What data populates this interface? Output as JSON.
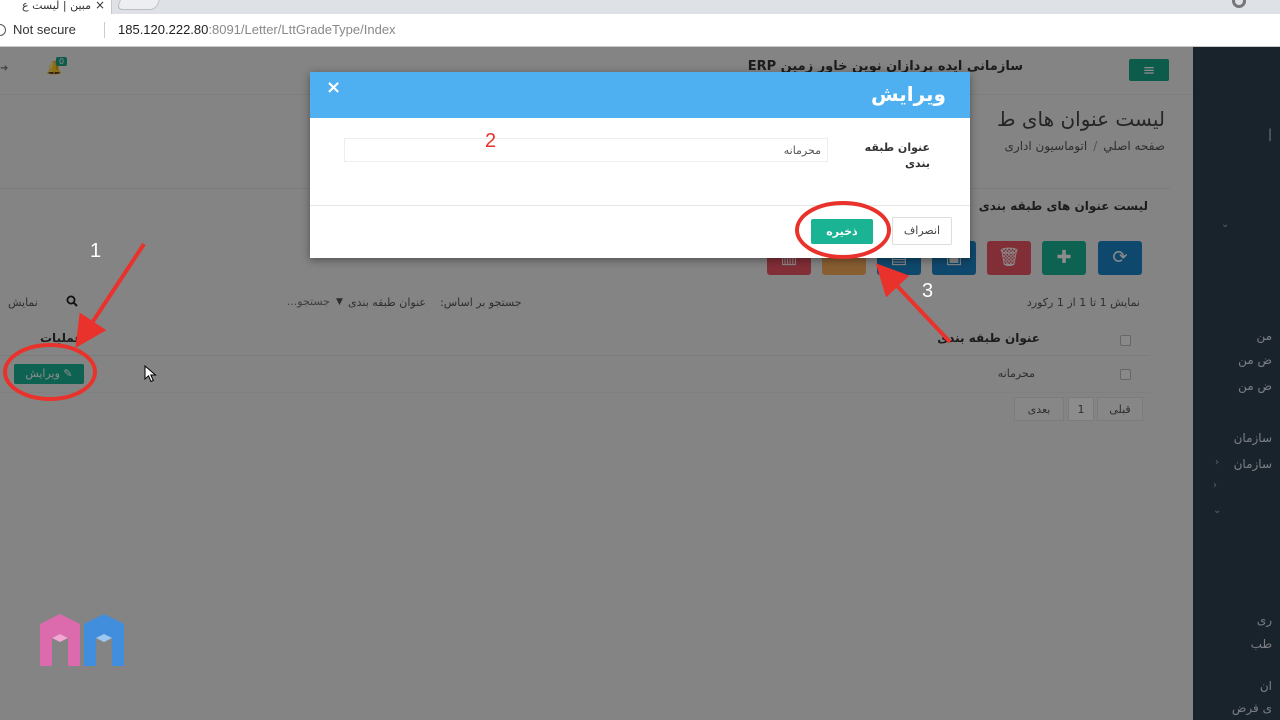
{
  "browser": {
    "tab_title": "مبین | لیست ع",
    "tab_close": "×",
    "security_label": "Not secure",
    "url_host": "185.120.222.80",
    "url_rest": ":8091/Letter/LttGradeType/Index"
  },
  "topbar": {
    "menu_icon": "≡",
    "brand": "سازمانی ایده پردازان نوین خاور زمین ERP",
    "bell_count": "0"
  },
  "sidebar": {
    "items": [
      "من",
      "ض من",
      "ض من",
      "سازمان",
      "سازمان",
      "ری",
      "طب",
      "ان",
      "ی فرض"
    ]
  },
  "page": {
    "title": "لیست عنوان های ط",
    "breadcrumb": [
      "صفحه اصلي",
      "اتوماسیون اداری"
    ]
  },
  "panel": {
    "title": "لیست عنوان های طبقه بندی",
    "records_info": "نمایش 1 تا 1 از 1 رکورد",
    "search_by_label": "جستجو بر اساس:",
    "search_by_value": "عنوان طبقه بندی",
    "search_placeholder": "جستجو...",
    "show_label": "نمایش"
  },
  "grid": {
    "columns": [
      "عنوان طبقه بندی",
      "عملیات"
    ],
    "rows": [
      {
        "title": "محرمانه",
        "action": "ویرایش"
      }
    ]
  },
  "pager": {
    "prev": "قبلی",
    "page": "1",
    "next": "بعدی"
  },
  "modal": {
    "title": "ویرایش",
    "close": "×",
    "field_label": "عنوان طبقه بندی",
    "field_value": "محرمانه",
    "cancel": "انصراف",
    "save": "ذخیره"
  },
  "annotations": [
    "1",
    "2",
    "3"
  ],
  "colors": {
    "accent_green": "#1ab394",
    "modal_header": "#4fb0f1",
    "sidebar": "#2f4050",
    "annotation_red": "#e8322b"
  }
}
